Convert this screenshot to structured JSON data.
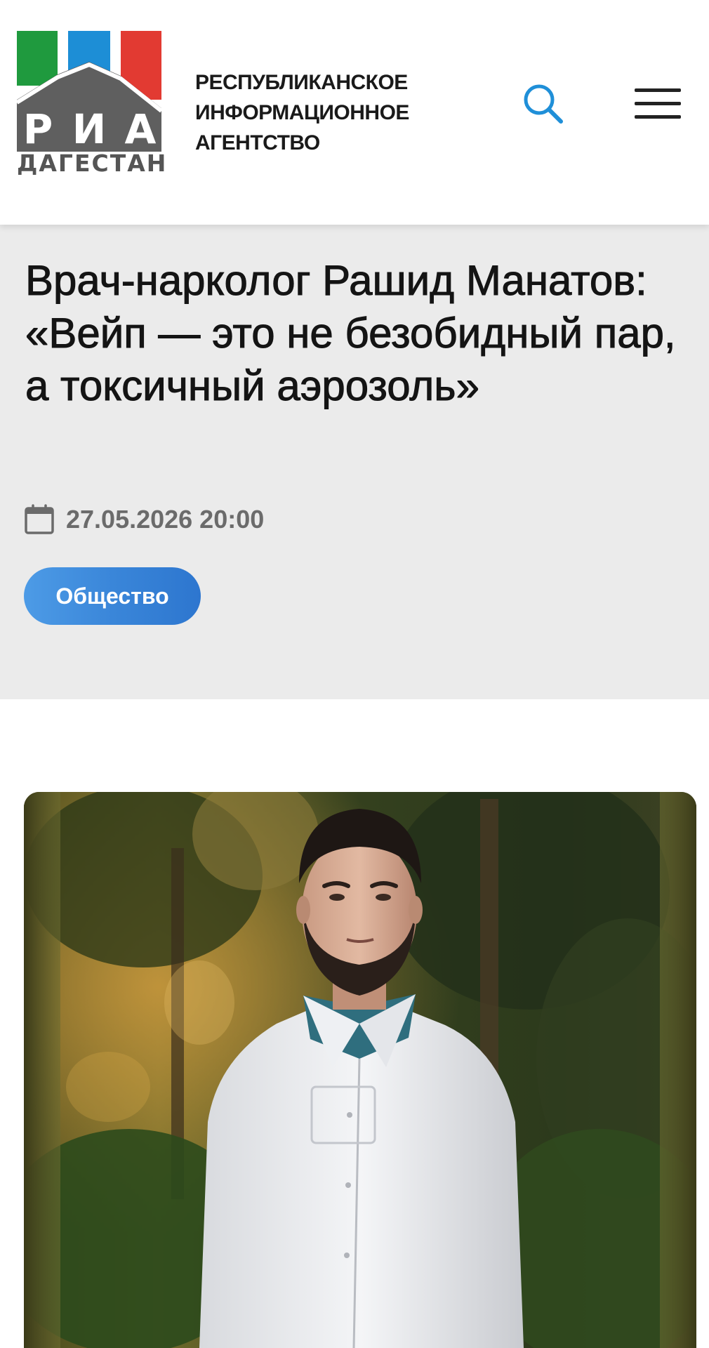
{
  "header": {
    "logo": {
      "letters": [
        "Р",
        "И",
        "А"
      ],
      "word": "ДАГЕСТАН",
      "flag_colors": [
        "#1f9a3e",
        "#1d8ed6",
        "#e23a32"
      ]
    },
    "agency_name": [
      "РЕСПУБЛИКАНСКОЕ",
      "ИНФОРМАЦИОННОЕ",
      "АГЕНТСТВО"
    ],
    "icons": {
      "search": "search-icon",
      "menu": "hamburger-menu-icon"
    }
  },
  "article": {
    "title": "Врач-нарколог Рашид Манатов: «Вейп — это не безобидный пар, а токсичный аэрозоль»",
    "date": "27.05.2026 20:00",
    "category": "Общество",
    "accent_color": "#3a86d9"
  },
  "photo": {
    "subject": "portrait-photo"
  }
}
